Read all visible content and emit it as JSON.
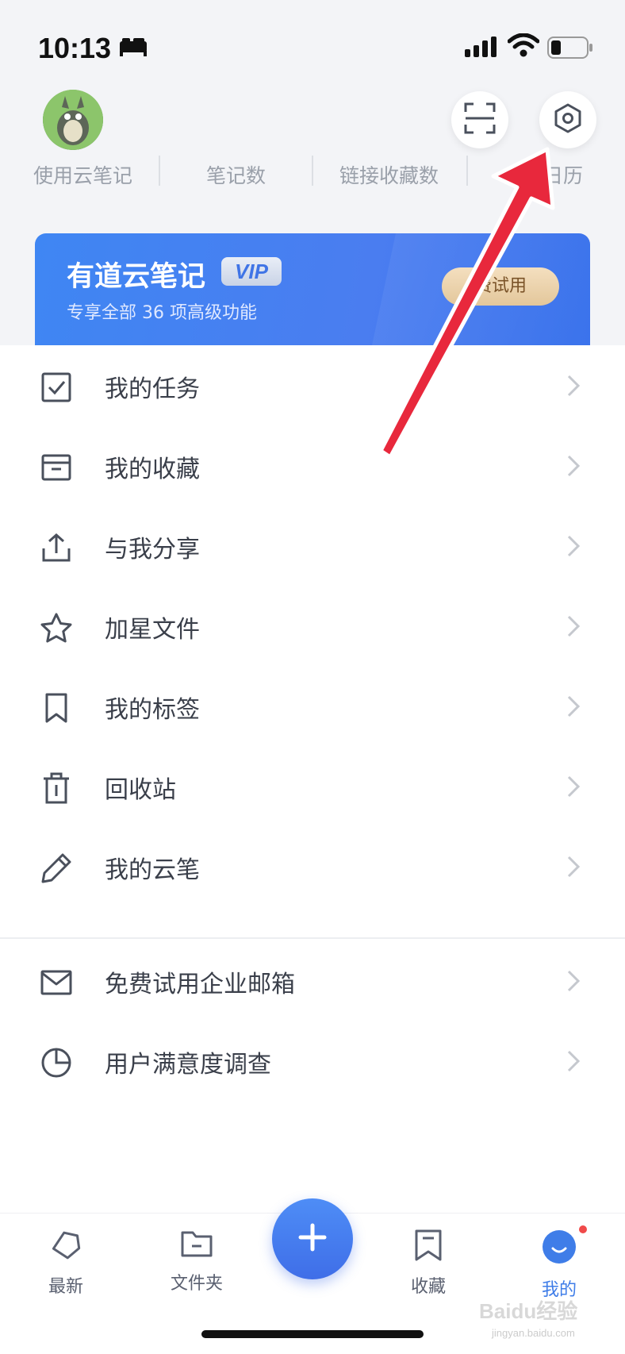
{
  "status_bar": {
    "time": "10:13",
    "icons": [
      "bed-icon",
      "signal-icon",
      "wifi-icon",
      "battery-icon"
    ]
  },
  "header": {
    "avatar": "avatar",
    "scan_icon": "scan-icon",
    "settings_icon": "settings-icon"
  },
  "stats": [
    {
      "label": "使用云笔记"
    },
    {
      "label": "笔记数"
    },
    {
      "label": "链接收藏数"
    },
    {
      "label": "日历"
    }
  ],
  "vip_banner": {
    "title": "有道云笔记",
    "badge": "VIP",
    "subtitle": "专享全部 36 项高级功能",
    "button_label": "费试用"
  },
  "menu": {
    "items": [
      {
        "label": "我的任务",
        "icon": "checkbox-icon"
      },
      {
        "label": "我的收藏",
        "icon": "archive-box-icon"
      },
      {
        "label": "与我分享",
        "icon": "share-upload-icon"
      },
      {
        "label": "加星文件",
        "icon": "star-icon"
      },
      {
        "label": "我的标签",
        "icon": "bookmark-icon"
      },
      {
        "label": "回收站",
        "icon": "trash-icon"
      },
      {
        "label": "我的云笔",
        "icon": "pen-icon"
      }
    ],
    "extra_items": [
      {
        "label": "免费试用企业邮箱",
        "icon": "mail-icon"
      },
      {
        "label": "用户满意度调查",
        "icon": "pie-chart-icon"
      }
    ]
  },
  "tab_bar": {
    "tabs": [
      {
        "label": "最新",
        "icon": "tag-icon",
        "active": false
      },
      {
        "label": "文件夹",
        "icon": "folder-icon",
        "active": false
      },
      {
        "label": "收藏",
        "icon": "bookmark-tab-icon",
        "active": false
      },
      {
        "label": "我的",
        "icon": "profile-face-icon",
        "active": true
      }
    ],
    "fab_icon": "plus-icon",
    "accent_color": "#3f7de8"
  },
  "watermark": {
    "text": "Baidu经验",
    "sub": "jingyan.baidu.com"
  },
  "colors": {
    "arrow": "#e8283c",
    "vip_gradient_start": "#3f86f3",
    "vip_gradient_end": "#3b73ec"
  }
}
